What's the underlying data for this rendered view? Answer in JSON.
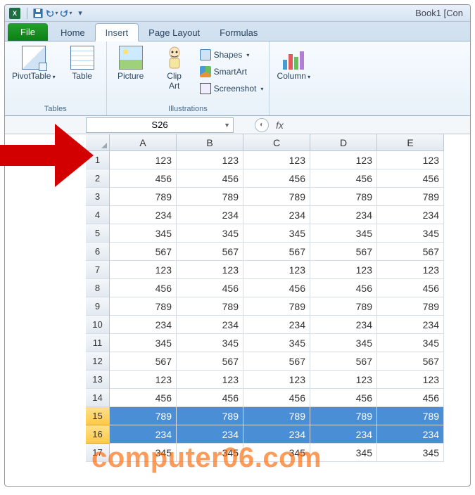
{
  "title": "Book1  [Con",
  "app_icon_letter": "X",
  "qat": {
    "down": "▾"
  },
  "tabs": {
    "file": "File",
    "home": "Home",
    "insert": "Insert",
    "page_layout": "Page Layout",
    "formulas": "Formulas"
  },
  "ribbon": {
    "tables_group": "Tables",
    "illustrations_group": "Illustrations",
    "pivottable": "PivotTable",
    "table": "Table",
    "picture": "Picture",
    "clipart_l1": "Clip",
    "clipart_l2": "Art",
    "shapes": "Shapes",
    "smartart": "SmartArt",
    "screenshot": "Screenshot",
    "column": "Column"
  },
  "namebox": "S26",
  "fx": "fx",
  "columns": [
    "A",
    "B",
    "C",
    "D",
    "E"
  ],
  "row_numbers": [
    1,
    2,
    3,
    4,
    5,
    6,
    7,
    8,
    9,
    10,
    11,
    12,
    13,
    14,
    15,
    16,
    17
  ],
  "rows": [
    [
      123,
      123,
      123,
      123,
      123
    ],
    [
      456,
      456,
      456,
      456,
      456
    ],
    [
      789,
      789,
      789,
      789,
      789
    ],
    [
      234,
      234,
      234,
      234,
      234
    ],
    [
      345,
      345,
      345,
      345,
      345
    ],
    [
      567,
      567,
      567,
      567,
      567
    ],
    [
      123,
      123,
      123,
      123,
      123
    ],
    [
      456,
      456,
      456,
      456,
      456
    ],
    [
      789,
      789,
      789,
      789,
      789
    ],
    [
      234,
      234,
      234,
      234,
      234
    ],
    [
      345,
      345,
      345,
      345,
      345
    ],
    [
      567,
      567,
      567,
      567,
      567
    ],
    [
      123,
      123,
      123,
      123,
      123
    ],
    [
      456,
      456,
      456,
      456,
      456
    ],
    [
      789,
      789,
      789,
      789,
      789
    ],
    [
      234,
      234,
      234,
      234,
      234
    ],
    [
      345,
      345,
      345,
      345,
      345
    ]
  ],
  "highlighted_rows": [
    15,
    16
  ],
  "watermark": "computer06.com"
}
